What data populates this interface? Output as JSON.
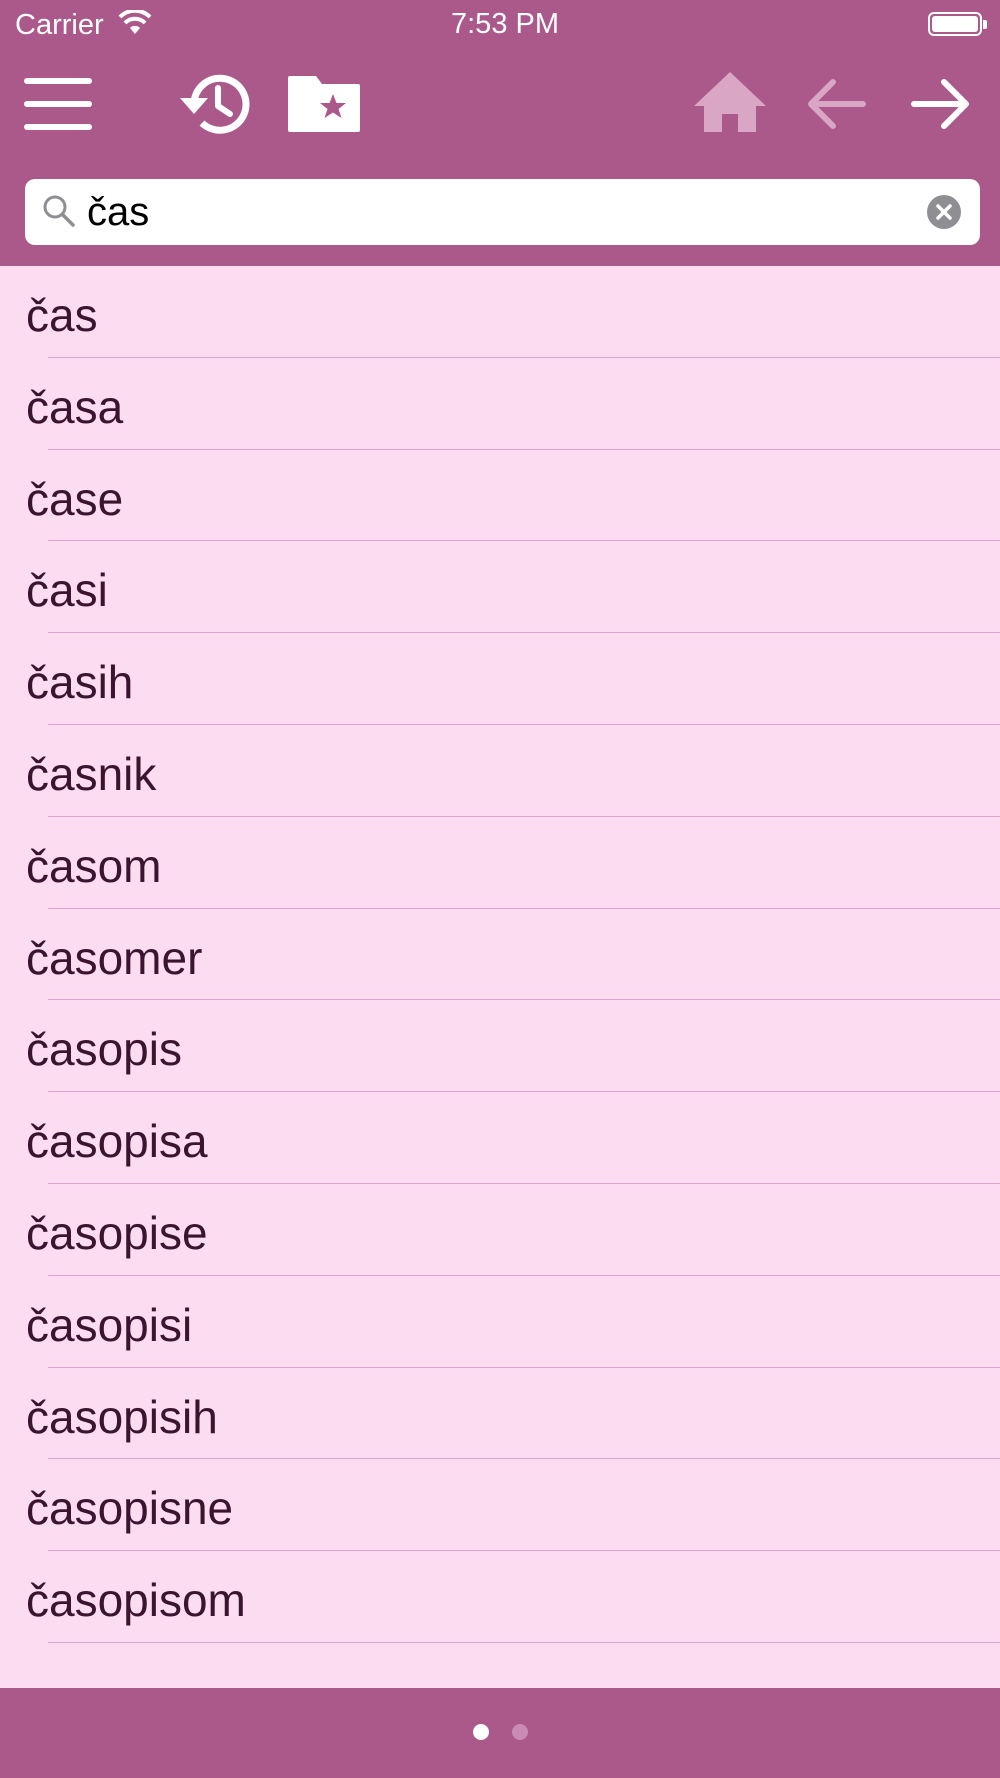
{
  "status_bar": {
    "carrier": "Carrier",
    "time": "7:53 PM"
  },
  "toolbar": {
    "icons": [
      "menu-icon",
      "history-icon",
      "favorites-folder-icon",
      "home-icon",
      "back-arrow-icon",
      "forward-arrow-icon"
    ],
    "home_enabled": false,
    "back_enabled": false,
    "forward_enabled": true
  },
  "search": {
    "value": "čas",
    "icon": "search-icon",
    "clear_icon": "clear-icon"
  },
  "results": [
    "čas",
    "časa",
    "čase",
    "časi",
    "časih",
    "časnik",
    "časom",
    "časomer",
    "časopis",
    "časopisa",
    "časopise",
    "časopisi",
    "časopisih",
    "časopisne",
    "časopisom"
  ],
  "pager": {
    "pages": 2,
    "current": 1
  },
  "colors": {
    "header": "#ab588b",
    "list_background": "#fcdcf1",
    "separator": "#e3a3cf",
    "text": "#3b1530",
    "disabled_icon": "#d9a6c6"
  }
}
